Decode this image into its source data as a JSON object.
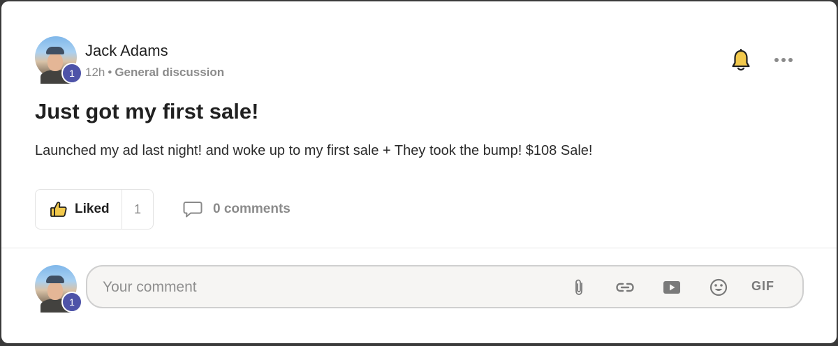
{
  "post": {
    "author": {
      "name": "Jack Adams",
      "level": "1"
    },
    "time": "12h",
    "separator": "•",
    "category": "General discussion",
    "title": "Just got my first sale!",
    "body": "Launched my ad last night! and woke up to my first sale + They took the bump! $108 Sale!",
    "actions": {
      "like_label": "Liked",
      "like_count": "1",
      "comments_label": "0 comments"
    },
    "icons": {
      "notify": "bell-icon",
      "more": "more-dots-icon",
      "like": "thumbs-up-icon",
      "comments": "comment-bubble-icon"
    }
  },
  "comment_box": {
    "avatar_level": "1",
    "placeholder": "Your comment",
    "tools": [
      "paperclip-icon",
      "link-icon",
      "video-icon",
      "emoji-icon"
    ],
    "gif_label": "GIF"
  },
  "colors": {
    "badge": "#4e53a8",
    "bell": "#f2c94c",
    "muted_text": "#8b8b8b"
  }
}
